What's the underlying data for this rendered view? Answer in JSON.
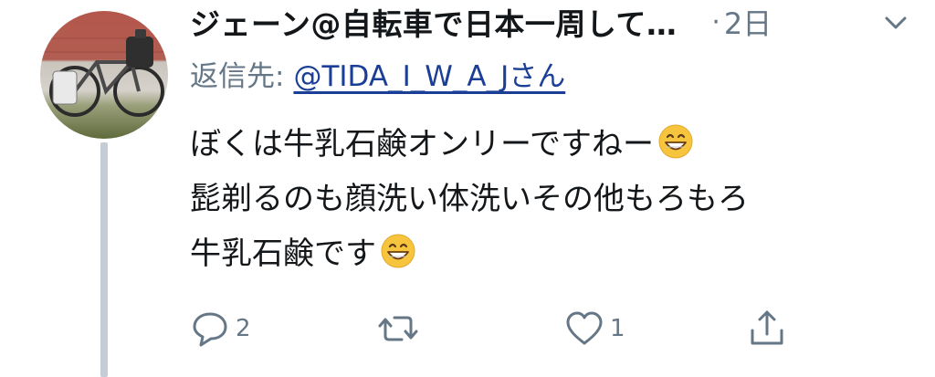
{
  "tweet": {
    "display_name": "ジェーン@自転車で日本一周して…",
    "time_separator": "·",
    "time": "2日",
    "reply_prefix": "返信先:",
    "reply_handle": "@TIDA_I_W_A_Jさん",
    "lines": [
      "ぼくは牛乳石鹸オンリーですねー",
      "髭剃るのも顔洗い体洗いその他もろもろ",
      "牛乳石鹸です"
    ]
  },
  "actions": {
    "reply_count": "2",
    "retweet_count": "",
    "like_count": "1"
  },
  "icons": {
    "avatar": "bicycle-photo",
    "caret": "chevron-down-icon",
    "emoji": "grinning-face-emoji",
    "reply": "speech-bubble-icon",
    "retweet": "retweet-icon",
    "like": "heart-icon",
    "share": "share-icon"
  },
  "colors": {
    "text": "#14171a",
    "secondary": "#657786",
    "link": "#1b3f96",
    "thread_line": "#c4cdd5"
  }
}
